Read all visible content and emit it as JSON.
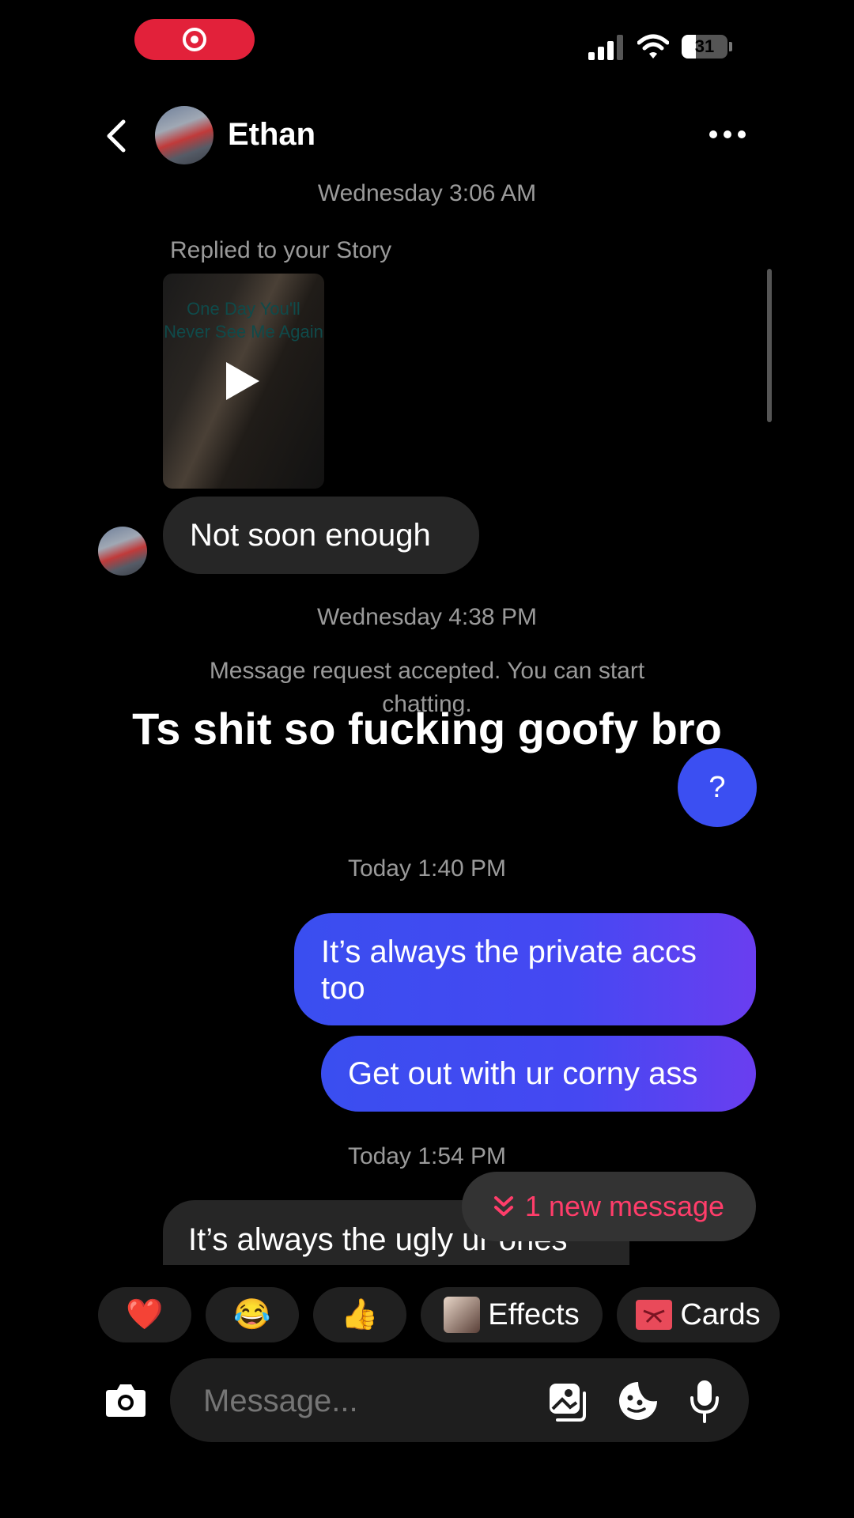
{
  "status_bar": {
    "battery": "31",
    "battery_level": 0.31
  },
  "header": {
    "contact_name": "Ethan"
  },
  "messages": {
    "timestamp_1": "Wednesday 3:06 AM",
    "story_reply_label": "Replied to your Story",
    "story_text": "One Day You'll Never See Me Again",
    "incoming_1": "Not soon enough",
    "timestamp_2": "Wednesday 4:38 PM",
    "system_notice": "Message request accepted. You can start chatting.",
    "timestamp_3": "Today 1:40 PM",
    "outgoing_1": "It’s always the private accs too",
    "outgoing_2": "Get out with ur corny ass",
    "timestamp_4": "Today 1:54 PM",
    "incoming_2": "It’s always the ugly ur ones being attention seekers"
  },
  "overlay_caption": "Ts shit so fucking goofy bro",
  "help_button": "?",
  "new_message_pill": {
    "label": "1 new message"
  },
  "quick_reactions": {
    "heart": "❤️",
    "laugh": "😂",
    "thumbs_up": "👍",
    "effects": "Effects",
    "cards": "Cards"
  },
  "composer": {
    "placeholder": "Message..."
  },
  "colors": {
    "outgoing_bubble": "#3a4ef0",
    "incoming_bubble": "#262626",
    "accent_pink": "#ff3d6a",
    "record_red": "#e2213a"
  }
}
